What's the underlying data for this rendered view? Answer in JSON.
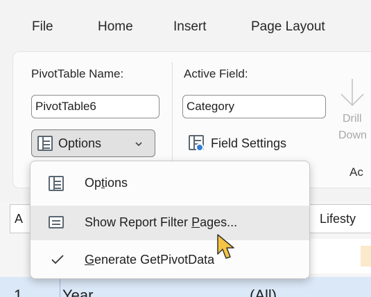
{
  "menu_tabs": [
    "File",
    "Home",
    "Insert",
    "Page Layout"
  ],
  "pivot_name": {
    "label": "PivotTable Name:",
    "value": "PivotTable6"
  },
  "active_field": {
    "label": "Active Field:",
    "value": "Category"
  },
  "options_button": {
    "label": "Options",
    "dropdown_icon": "chevron-down-icon"
  },
  "field_settings": {
    "label": "Field Settings"
  },
  "drill_down": {
    "line1": "Drill",
    "line2": "Down"
  },
  "ribbon_partial": {
    "active_group_label": "Ac"
  },
  "sheet": {
    "col_a_partial": "A",
    "lifestyle_partial": "Lifesty",
    "row1_number": "1",
    "row1_label": "Year",
    "row1_value": "(All)"
  },
  "dropdown_menu": {
    "items": [
      {
        "pre": "Op",
        "underlined": "t",
        "post": "ions",
        "icon": "options-table-icon"
      },
      {
        "pre": "Show Report Filter ",
        "underlined": "P",
        "post": "ages...",
        "icon": "report-filter-pages-icon"
      },
      {
        "pre": "",
        "underlined": "G",
        "post": "enerate GetPivotData",
        "icon": "checkmark-icon"
      }
    ]
  },
  "colors": {
    "accent_yellow": "#f5c445",
    "menu_bg": "#fcfcfc"
  }
}
